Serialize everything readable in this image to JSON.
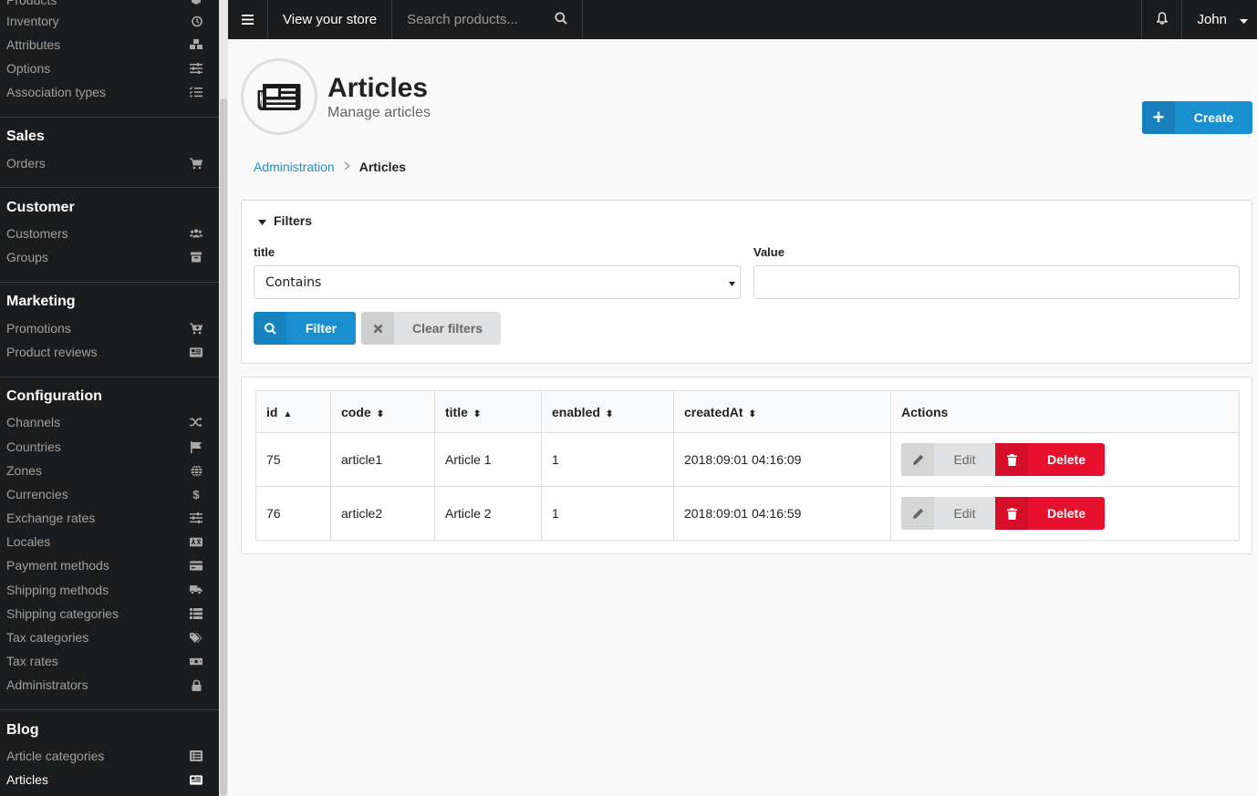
{
  "sidebar": {
    "top_items": [
      {
        "label": "Products",
        "icon": "cube-icon"
      },
      {
        "label": "Inventory",
        "icon": "history-icon"
      },
      {
        "label": "Attributes",
        "icon": "cubes-icon"
      },
      {
        "label": "Options",
        "icon": "sliders-icon"
      },
      {
        "label": "Association types",
        "icon": "tasks-icon"
      }
    ],
    "sections": [
      {
        "title": "Sales",
        "items": [
          {
            "label": "Orders",
            "icon": "cart-icon"
          }
        ]
      },
      {
        "title": "Customer",
        "items": [
          {
            "label": "Customers",
            "icon": "users-icon"
          },
          {
            "label": "Groups",
            "icon": "archive-icon"
          }
        ]
      },
      {
        "title": "Marketing",
        "items": [
          {
            "label": "Promotions",
            "icon": "cart-plus-icon"
          },
          {
            "label": "Product reviews",
            "icon": "newspaper-icon"
          }
        ]
      },
      {
        "title": "Configuration",
        "items": [
          {
            "label": "Channels",
            "icon": "random-icon"
          },
          {
            "label": "Countries",
            "icon": "flag-icon"
          },
          {
            "label": "Zones",
            "icon": "globe-icon"
          },
          {
            "label": "Currencies",
            "icon": "dollar-icon"
          },
          {
            "label": "Exchange rates",
            "icon": "sliders-icon"
          },
          {
            "label": "Locales",
            "icon": "translate-icon"
          },
          {
            "label": "Payment methods",
            "icon": "credit-card-icon"
          },
          {
            "label": "Shipping methods",
            "icon": "truck-icon"
          },
          {
            "label": "Shipping categories",
            "icon": "list-icon"
          },
          {
            "label": "Tax categories",
            "icon": "tags-icon"
          },
          {
            "label": "Tax rates",
            "icon": "money-icon"
          },
          {
            "label": "Administrators",
            "icon": "lock-icon"
          }
        ]
      },
      {
        "title": "Blog",
        "items": [
          {
            "label": "Article categories",
            "icon": "list-alt-icon"
          },
          {
            "label": "Articles",
            "icon": "newspaper-icon",
            "active": true
          }
        ]
      }
    ]
  },
  "topbar": {
    "view_store": "View your store",
    "search_placeholder": "Search products...",
    "user": "John"
  },
  "page": {
    "title": "Articles",
    "subtitle": "Manage articles",
    "create_label": "Create"
  },
  "breadcrumb": {
    "root": "Administration",
    "current": "Articles"
  },
  "filters": {
    "heading": "Filters",
    "field_label": "title",
    "field_select_value": "Contains",
    "value_label": "Value",
    "value_input": "",
    "filter_label": "Filter",
    "clear_label": "Clear filters"
  },
  "table": {
    "columns": [
      "id",
      "code",
      "title",
      "enabled",
      "createdAt",
      "Actions"
    ],
    "rows": [
      {
        "id": "75",
        "code": "article1",
        "title": "Article 1",
        "enabled": "1",
        "createdAt": "2018:09:01 04:16:09"
      },
      {
        "id": "76",
        "code": "article2",
        "title": "Article 2",
        "enabled": "1",
        "createdAt": "2018:09:01 04:16:59"
      }
    ],
    "edit_label": "Edit",
    "delete_label": "Delete"
  },
  "colors": {
    "primary": "#1a8fd0",
    "danger": "#e8112d",
    "sidebar_bg": "#1b1c1d"
  }
}
